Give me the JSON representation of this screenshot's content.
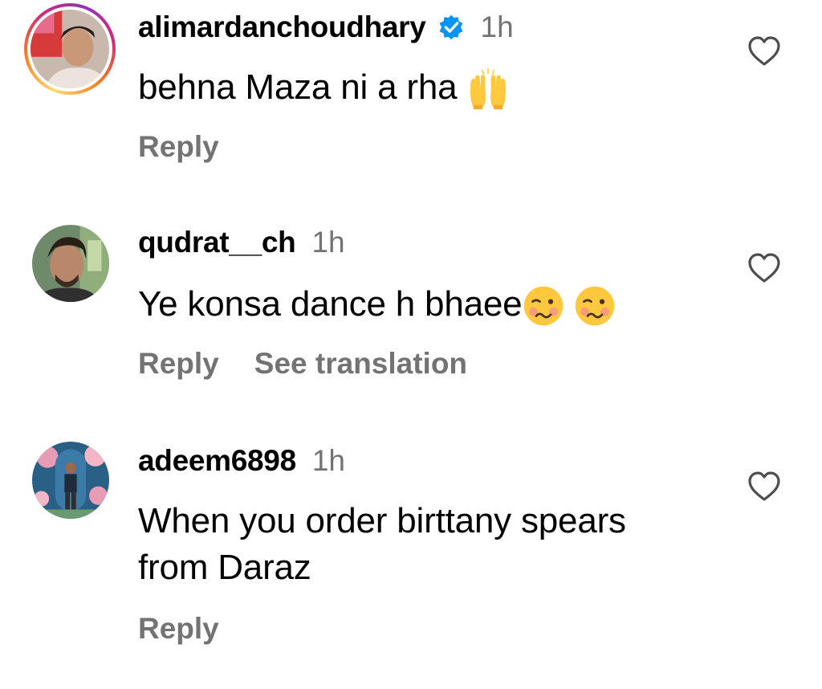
{
  "comments": [
    {
      "username": "alimardanchoudhary",
      "verified": true,
      "time": "1h",
      "text": "behna Maza ni a rha ",
      "emoji_after": [
        "raising-hands-emoji"
      ],
      "actions": [
        "Reply"
      ],
      "has_story_ring": true
    },
    {
      "username": "qudrat__ch",
      "verified": false,
      "time": "1h",
      "text": "Ye konsa dance h bhaee",
      "emoji_after": [
        "woozy-face-emoji",
        "woozy-face-emoji"
      ],
      "actions": [
        "Reply",
        "See translation"
      ],
      "has_story_ring": false
    },
    {
      "username": "adeem6898",
      "verified": false,
      "time": "1h",
      "text_lines": [
        "When you order birttany spears",
        "from Daraz"
      ],
      "actions": [
        "Reply"
      ],
      "has_story_ring": false
    }
  ],
  "colors": {
    "text": "#000000",
    "secondary": "#737373",
    "verified_badge": "#0095f6",
    "background": "#ffffff"
  },
  "icons": {
    "like": "heart-outline-icon",
    "verified": "verified-badge-icon"
  }
}
